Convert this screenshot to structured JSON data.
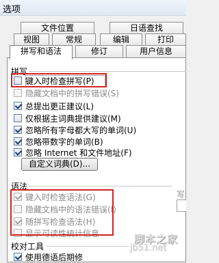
{
  "window": {
    "title": "选项"
  },
  "tabs_row1": [
    {
      "label": "文件位置"
    },
    {
      "label": "日语查找"
    }
  ],
  "tabs_row2": [
    {
      "label": "视图"
    },
    {
      "label": "常规"
    },
    {
      "label": "编辑"
    },
    {
      "label": "打印"
    }
  ],
  "tabs_row3": [
    {
      "label": "拼写和语法",
      "active": true
    },
    {
      "label": "修订"
    },
    {
      "label": "用户信息"
    }
  ],
  "spelling": {
    "group_label": "拼写",
    "options": [
      {
        "label": "键入时检查拼写(P)",
        "checked": false
      },
      {
        "label": "隐藏文档中的拼写错误(S)",
        "checked": false,
        "disabled": true
      },
      {
        "label": "总提出更正建议(L)",
        "checked": true
      },
      {
        "label": "仅根据主词典提供建议(M)",
        "checked": false
      },
      {
        "label": "忽略所有字母都大写的单词(U)",
        "checked": true
      },
      {
        "label": "忽略带数字的单词(B)",
        "checked": true
      },
      {
        "label": "忽略 Internet 和文件地址(F)",
        "checked": true
      }
    ],
    "custom_dict_button": "自定义词典(D)..."
  },
  "grammar": {
    "group_label": "语法",
    "options": [
      {
        "label": "键入时检查语法(G)",
        "checked": true,
        "disabled": true
      },
      {
        "label": "隐藏文档中的语法错误(I)",
        "checked": false,
        "disabled": true
      },
      {
        "label": "随拼写检查语法(H)",
        "checked": true,
        "disabled": true
      },
      {
        "label": "显示可读性统计信息",
        "checked": false,
        "disabled": true
      }
    ],
    "right_label_fragment": "写"
  },
  "proofing": {
    "group_label": "校对工具",
    "options": [
      {
        "label": "使用德语后期修",
        "checked": true
      }
    ]
  },
  "watermark": {
    "line1": "脚本之家",
    "line2": "jb51.net"
  },
  "colors": {
    "highlight_box": "#d42121",
    "checkbox_border": "#5b7aa6"
  }
}
